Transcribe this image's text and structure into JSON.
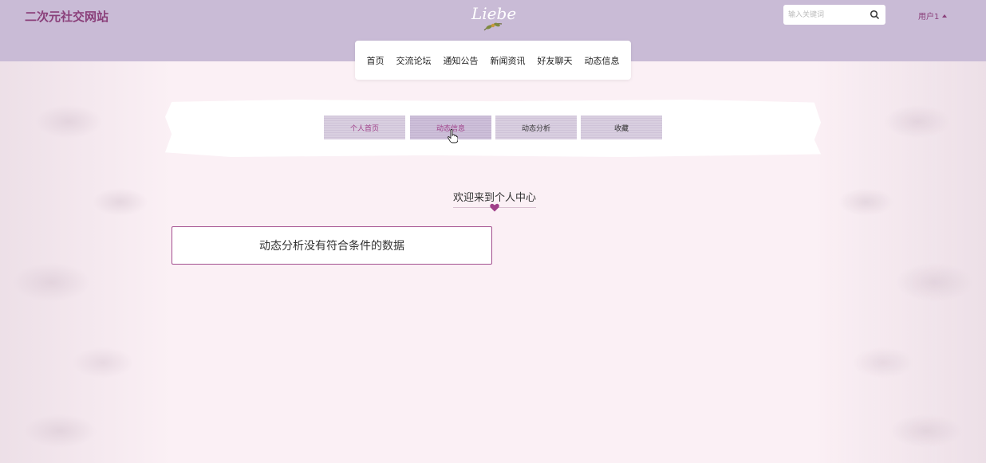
{
  "header": {
    "site_title": "二次元社交网站",
    "logo_text": "Liebe",
    "search": {
      "placeholder": "输入关键词",
      "value": ""
    },
    "user_label": "用户1"
  },
  "nav": {
    "items": [
      {
        "label": "首页"
      },
      {
        "label": "交流论坛"
      },
      {
        "label": "通知公告"
      },
      {
        "label": "新闻资讯"
      },
      {
        "label": "好友聊天"
      },
      {
        "label": "动态信息"
      }
    ]
  },
  "tabs": [
    {
      "label": "个人首页"
    },
    {
      "label": "动态信息"
    },
    {
      "label": "动态分析"
    },
    {
      "label": "收藏"
    }
  ],
  "welcome": {
    "title": "欢迎来到个人中心"
  },
  "empty_message": "动态分析没有符合条件的数据",
  "colors": {
    "header_bg": "#c9bbd6",
    "accent": "#8a3f7a",
    "page_bg": "#fbf0f5"
  }
}
